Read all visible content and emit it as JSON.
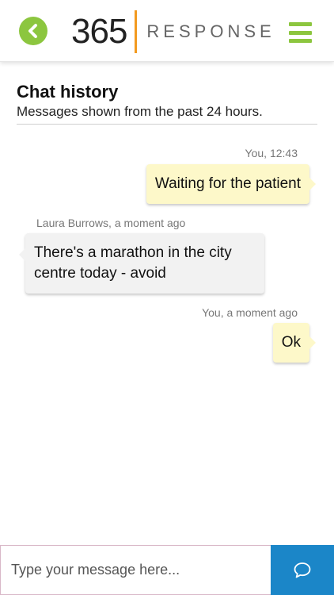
{
  "header": {
    "logo_number": "365",
    "logo_word": "RESPONSE",
    "back_icon": "chevron-left-icon",
    "menu_icon": "hamburger-menu-icon"
  },
  "chat": {
    "title": "Chat history",
    "subtitle": "Messages shown from the past 24 hours.",
    "messages": [
      {
        "direction": "out",
        "meta": "You, 12:43",
        "text": "Waiting for the patient"
      },
      {
        "direction": "in",
        "meta": "Laura Burrows, a moment ago",
        "text": "There's a marathon in the city centre today - avoid"
      },
      {
        "direction": "out",
        "meta": "You, a moment ago",
        "text": "Ok"
      }
    ]
  },
  "composer": {
    "placeholder": "Type your message here...",
    "value": "",
    "send_icon": "chat-bubble-icon"
  },
  "colors": {
    "accent_green": "#8cc63f",
    "logo_bar_orange": "#f29a1f",
    "send_blue": "#1b86c8",
    "outgoing_bubble": "#fdf8c9",
    "incoming_bubble": "#f2f2f2"
  }
}
